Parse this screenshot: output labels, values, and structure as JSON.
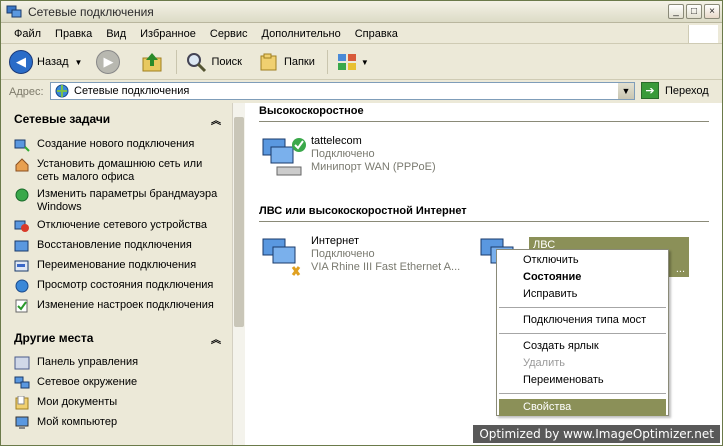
{
  "window": {
    "title": "Сетевые подключения",
    "min": "_",
    "max": "□",
    "close": "×"
  },
  "menu": [
    "Файл",
    "Правка",
    "Вид",
    "Избранное",
    "Сервис",
    "Дополнительно",
    "Справка"
  ],
  "toolbar": {
    "back": "Назад",
    "search": "Поиск",
    "folders": "Папки"
  },
  "address": {
    "label": "Адрес:",
    "value": "Сетевые подключения",
    "go": "Переход"
  },
  "left": {
    "net_tasks_title": "Сетевые задачи",
    "tasks": [
      "Создание нового подключения",
      "Установить домашнюю сеть или сеть малого офиса",
      "Изменить параметры брандмауэра Windows",
      "Отключение сетевого устройства",
      "Восстановление подключения",
      "Переименование подключения",
      "Просмотр состояния подключения",
      "Изменение настроек подключения"
    ],
    "places_title": "Другие места",
    "places": [
      "Панель управления",
      "Сетевое окружение",
      "Мои документы",
      "Мой компьютер"
    ]
  },
  "right": {
    "group1": "Высокоскоростное",
    "conn1": {
      "name": "tattelecom",
      "status": "Подключено",
      "device": "Минипорт WAN (PPPoE)"
    },
    "group2": "ЛВС или высокоскоростной Интернет",
    "conn2": {
      "name": "Интернет",
      "status": "Подключено",
      "device": "VIA Rhine III Fast Ethernet A..."
    },
    "conn3": {
      "name": "ЛВС",
      "device": "..."
    }
  },
  "context_menu": {
    "disconnect": "Отключить",
    "status": "Состояние",
    "repair": "Исправить",
    "bridge": "Подключения типа мост",
    "shortcut": "Создать ярлык",
    "delete": "Удалить",
    "rename": "Переименовать",
    "properties": "Свойства"
  },
  "watermark": "Optimized by www.ImageOptimizer.net"
}
